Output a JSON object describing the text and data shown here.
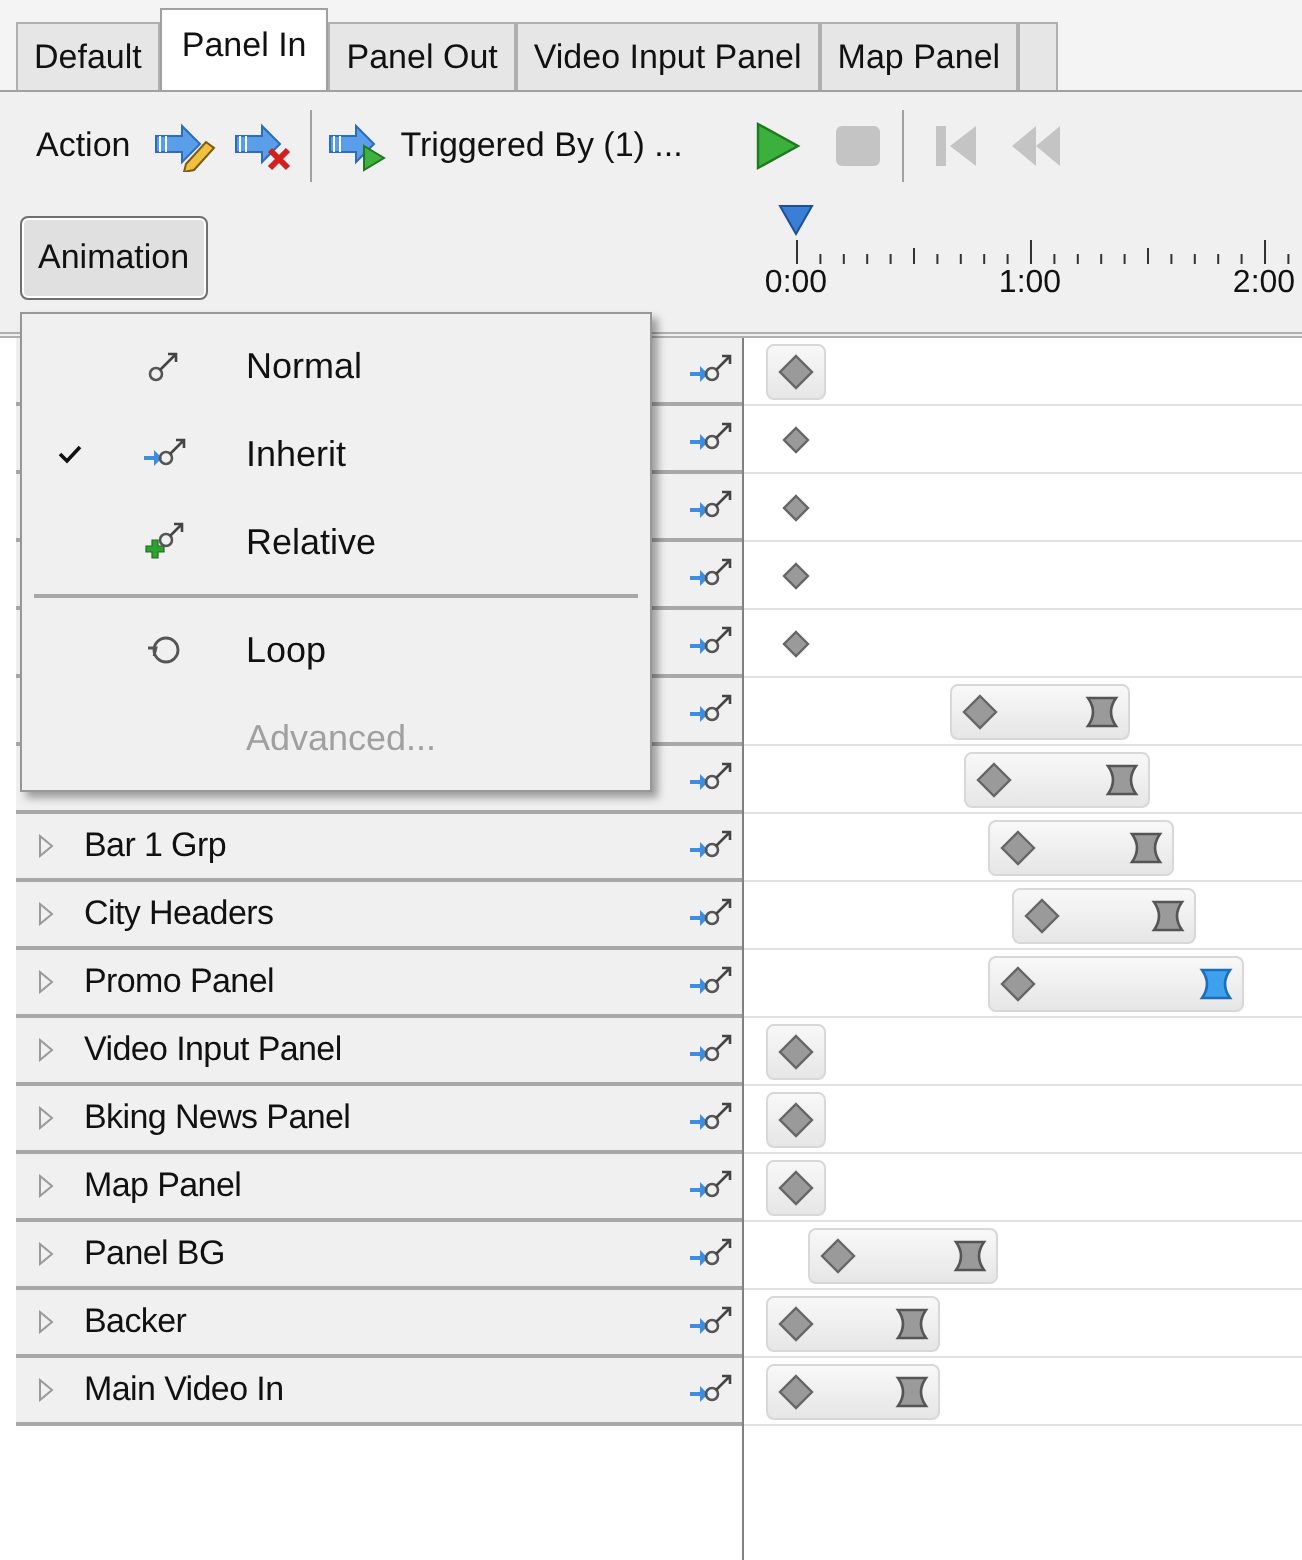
{
  "tabs": [
    {
      "label": "Default",
      "selected": false
    },
    {
      "label": "Panel In",
      "selected": true
    },
    {
      "label": "Panel Out",
      "selected": false
    },
    {
      "label": "Video Input Panel",
      "selected": false
    },
    {
      "label": "Map Panel",
      "selected": false
    }
  ],
  "toolbar": {
    "action_label": "Action",
    "trigger_label": "Triggered By (1) ...",
    "controls": [
      {
        "kind": "play",
        "disabled": false
      },
      {
        "kind": "stop",
        "disabled": true
      },
      {
        "kind": "skip-start",
        "disabled": true
      },
      {
        "kind": "rewind",
        "disabled": true
      }
    ]
  },
  "animation_button": {
    "label": "Animation",
    "expanded": true
  },
  "ruler": {
    "labels": [
      "0:00",
      "1:00",
      "2:00"
    ]
  },
  "menu": [
    {
      "kind": "normal",
      "label": "Normal",
      "checked": false,
      "disabled": false
    },
    {
      "kind": "inherit",
      "label": "Inherit",
      "checked": true,
      "disabled": false
    },
    {
      "kind": "relative",
      "label": "Relative",
      "checked": false,
      "disabled": false
    },
    {
      "kind": "separator"
    },
    {
      "kind": "loop",
      "label": "Loop",
      "checked": false,
      "disabled": false
    },
    {
      "kind": "plain",
      "label": "Advanced...",
      "checked": false,
      "disabled": true
    }
  ],
  "rows": [
    {
      "track": {
        "kind": "point"
      }
    },
    {
      "track": {
        "kind": "dot"
      }
    },
    {
      "track": {
        "kind": "dot"
      }
    },
    {
      "track": {
        "kind": "dot"
      }
    },
    {
      "track": {
        "kind": "dot"
      }
    },
    {
      "track": {
        "kind": "span",
        "end_selected": false
      }
    },
    {
      "track": {
        "kind": "span",
        "end_selected": false
      }
    },
    {
      "name": "Bar 1 Grp",
      "expanded": false,
      "track": {
        "kind": "span",
        "end_selected": false
      }
    },
    {
      "name": "City Headers",
      "expanded": false,
      "track": {
        "kind": "span",
        "end_selected": false
      }
    },
    {
      "name": "Promo Panel",
      "expanded": false,
      "track": {
        "kind": "span",
        "end_selected": true
      }
    },
    {
      "name": "Video Input Panel",
      "expanded": false,
      "track": {
        "kind": "point"
      }
    },
    {
      "name": "Bking News Panel",
      "expanded": false,
      "track": {
        "kind": "point"
      }
    },
    {
      "name": "Map Panel",
      "expanded": false,
      "track": {
        "kind": "point"
      }
    },
    {
      "name": "Panel BG",
      "expanded": false,
      "track": {
        "kind": "span",
        "end_selected": false
      }
    },
    {
      "name": "Backer",
      "expanded": false,
      "track": {
        "kind": "span",
        "end_selected": false
      }
    },
    {
      "name": "Main Video In",
      "expanded": false,
      "track": {
        "kind": "span",
        "end_selected": false
      }
    }
  ]
}
